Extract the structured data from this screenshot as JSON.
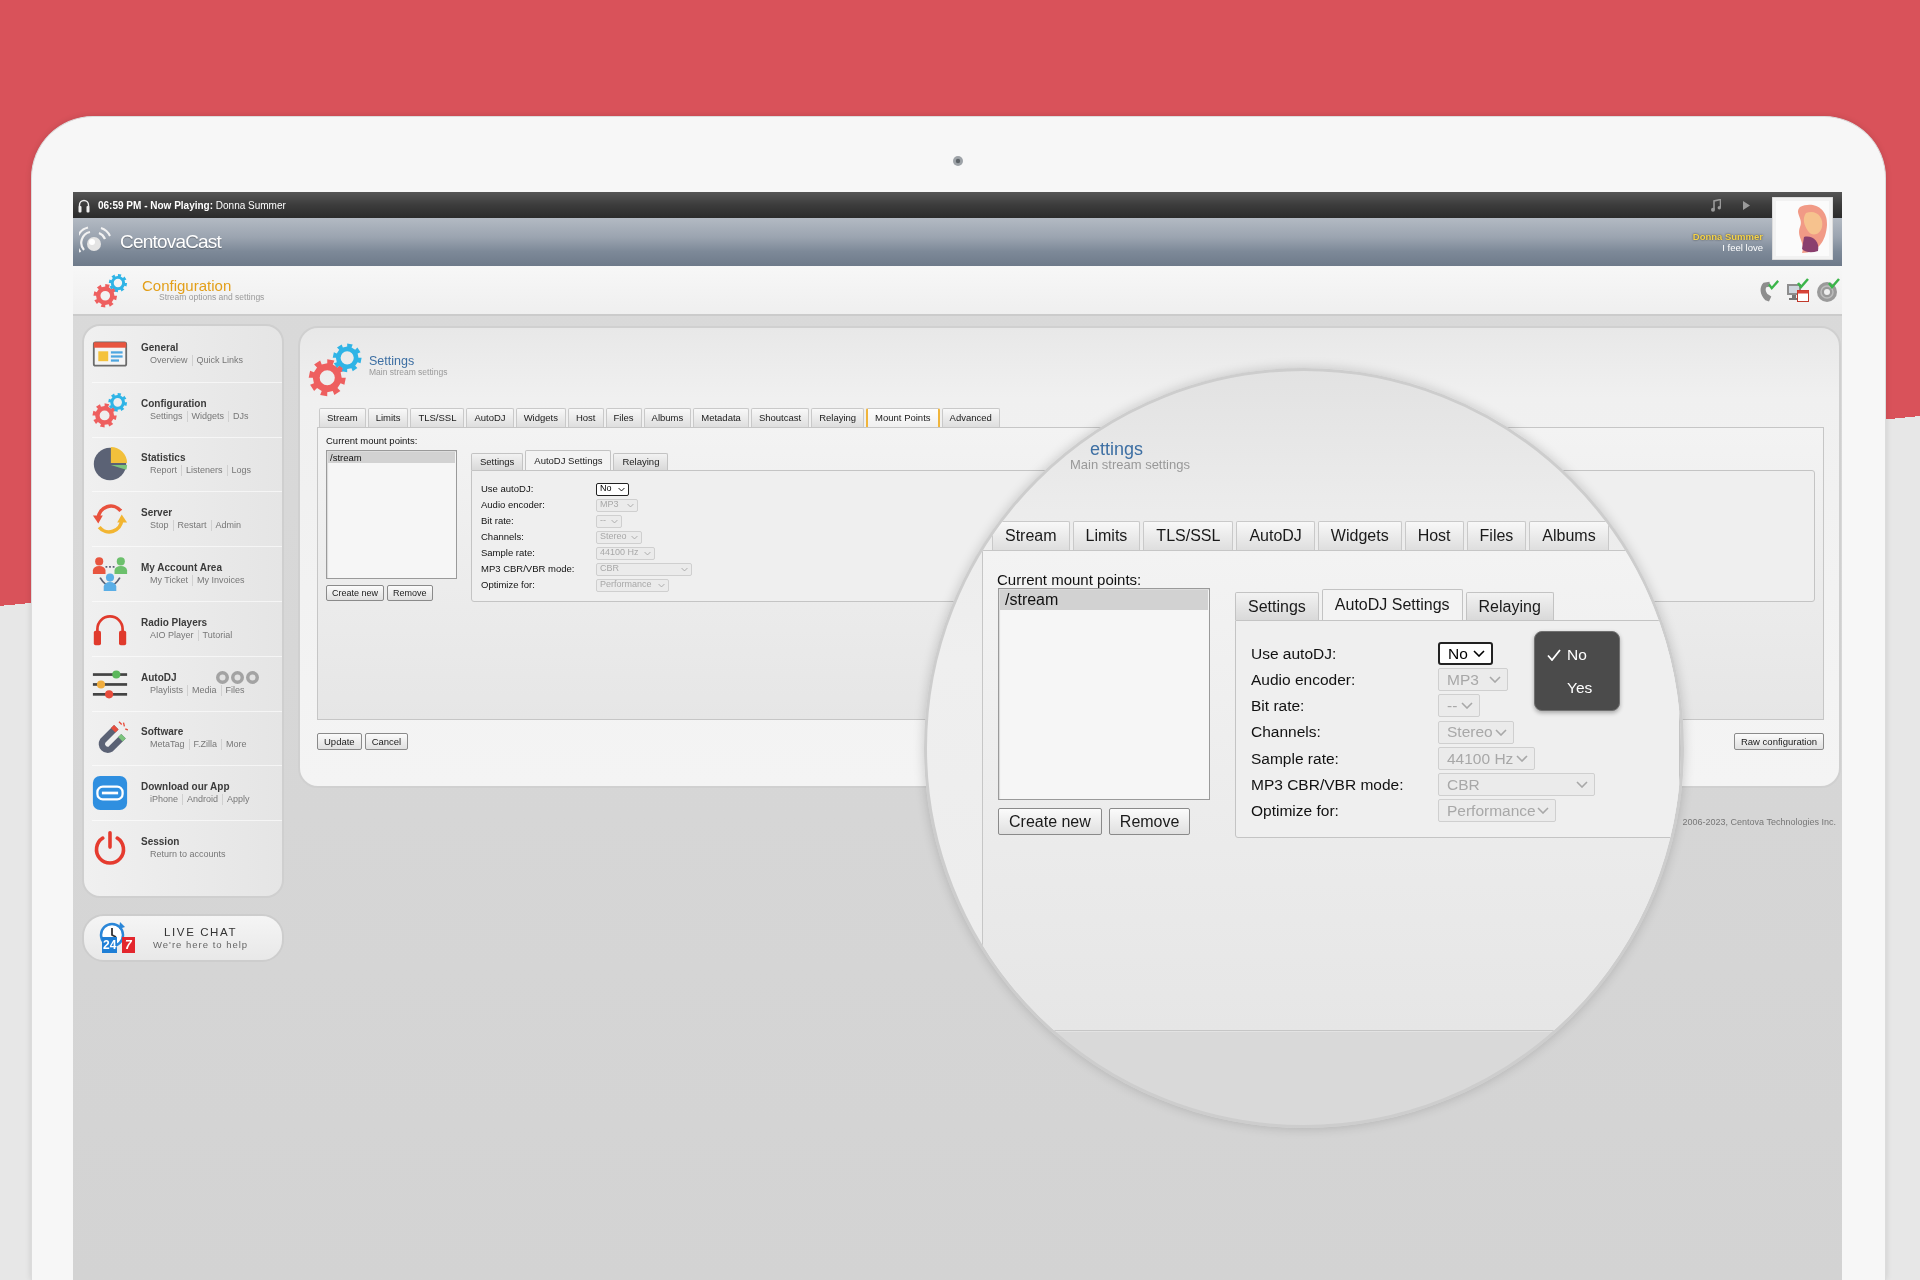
{
  "top_bar": {
    "now_playing": "**06:59 PM - Now Playing:** Donna Summer"
  },
  "header": {
    "logo": "CentovaCast",
    "artist": "Donna Summer",
    "track": "I feel love"
  },
  "page_header": {
    "title": "Configuration",
    "subtitle": "Stream options and settings"
  },
  "sidebar": {
    "items": [
      {
        "title": "General",
        "links": [
          "Overview",
          "Quick Links"
        ]
      },
      {
        "title": "Configuration",
        "links": [
          "Settings",
          "Widgets",
          "DJs"
        ]
      },
      {
        "title": "Statistics",
        "links": [
          "Report",
          "Listeners",
          "Logs"
        ]
      },
      {
        "title": "Server",
        "links": [
          "Stop",
          "Restart",
          "Admin"
        ]
      },
      {
        "title": "My Account Area",
        "links": [
          "My Ticket",
          "My Invoices"
        ]
      },
      {
        "title": "Radio Players",
        "links": [
          "AIO Player",
          "Tutorial"
        ]
      },
      {
        "title": "AutoDJ",
        "links": [
          "Playlists",
          "Media",
          "Files"
        ]
      },
      {
        "title": "Software",
        "links": [
          "MetaTag",
          "F.Zilla",
          "More"
        ]
      },
      {
        "title": "Download our App",
        "links": [
          "iPhone",
          "Android",
          "Apply"
        ]
      },
      {
        "title": "Session",
        "links": [
          "Return to accounts"
        ]
      }
    ]
  },
  "live_chat": {
    "title": "LIVE CHAT",
    "subtitle": "We're here to help",
    "hours": "24",
    "days": "7"
  },
  "settings": {
    "title": "Settings",
    "subtitle": "Main stream settings",
    "tabs": [
      {
        "label": "Stream",
        "selected": false
      },
      {
        "label": "Limits",
        "selected": false
      },
      {
        "label": "TLS/SSL",
        "selected": false
      },
      {
        "label": "AutoDJ",
        "selected": false
      },
      {
        "label": "Widgets",
        "selected": false
      },
      {
        "label": "Host",
        "selected": false
      },
      {
        "label": "Files",
        "selected": false
      },
      {
        "label": "Albums",
        "selected": false
      },
      {
        "label": "Metadata",
        "selected": false
      },
      {
        "label": "Shoutcast",
        "selected": false
      },
      {
        "label": "Relaying",
        "selected": false
      },
      {
        "label": "Mount Points",
        "selected": true
      },
      {
        "label": "Advanced",
        "selected": false
      }
    ],
    "mount_points": {
      "label": "Current mount points:",
      "items": [
        {
          "label": "/stream",
          "selected": true
        }
      ],
      "buttons": [
        "Create new",
        "Remove"
      ]
    },
    "sub_tabs": [
      {
        "label": "Settings",
        "selected": false
      },
      {
        "label": "AutoDJ Settings",
        "selected": true
      },
      {
        "label": "Relaying",
        "selected": false
      }
    ],
    "fields": [
      {
        "label": "Use autoDJ:",
        "value": "No",
        "disabled": false
      },
      {
        "label": "Audio encoder:",
        "value": "MP3",
        "disabled": true
      },
      {
        "label": "Bit rate:",
        "value": "--",
        "disabled": true
      },
      {
        "label": "Channels:",
        "value": "Stereo",
        "disabled": true
      },
      {
        "label": "Sample rate:",
        "value": "44100 Hz",
        "disabled": true
      },
      {
        "label": "MP3 CBR/VBR mode:",
        "value": "CBR",
        "disabled": true
      },
      {
        "label": "Optimize for:",
        "value": "Performance",
        "disabled": true
      }
    ],
    "buttons": [
      "Update",
      "Cancel"
    ],
    "raw_button": "Raw configuration"
  },
  "copyright": "2006-2023, Centova Technologies Inc.",
  "magnifier": {
    "title": "ettings",
    "subtitle": "Main stream settings",
    "tabs": [
      {
        "label": "Stream",
        "selected": false
      },
      {
        "label": "Limits",
        "selected": false
      },
      {
        "label": "TLS/SSL",
        "selected": false
      },
      {
        "label": "AutoDJ",
        "selected": false
      },
      {
        "label": "Widgets",
        "selected": false
      },
      {
        "label": "Host",
        "selected": false
      },
      {
        "label": "Files",
        "selected": false
      },
      {
        "label": "Albums",
        "selected": false
      }
    ],
    "mount_points": {
      "label": "Current mount points:",
      "items": [
        {
          "label": "/stream",
          "selected": true
        }
      ],
      "buttons": [
        "Create new",
        "Remove"
      ]
    },
    "sub_tabs": [
      {
        "label": "Settings",
        "selected": false
      },
      {
        "label": "AutoDJ Settings",
        "selected": true
      },
      {
        "label": "Relaying",
        "selected": false
      }
    ],
    "fields": [
      {
        "label": "Use autoDJ:",
        "value": "No",
        "disabled": false
      },
      {
        "label": "Audio encoder:",
        "value": "MP3",
        "disabled": true
      },
      {
        "label": "Bit rate:",
        "value": "--",
        "disabled": true
      },
      {
        "label": "Channels:",
        "value": "Stereo",
        "disabled": true
      },
      {
        "label": "Sample rate:",
        "value": "44100 Hz",
        "disabled": true
      },
      {
        "label": "MP3 CBR/VBR mode:",
        "value": "CBR",
        "disabled": true
      },
      {
        "label": "Optimize for:",
        "value": "Performance",
        "disabled": true
      }
    ],
    "dropdown": {
      "options": [
        {
          "label": "No",
          "selected": true
        },
        {
          "label": "Yes",
          "selected": false
        }
      ]
    }
  }
}
